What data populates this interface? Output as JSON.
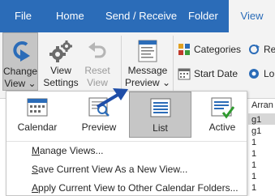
{
  "tabs": [
    "File",
    "Home",
    "Send / Receive",
    "Folder",
    "View"
  ],
  "ribbon": {
    "change_view": [
      "Change",
      "View"
    ],
    "change_view_arrow": "⌄",
    "view_settings": [
      "View",
      "Settings"
    ],
    "reset_view": [
      "Reset",
      "View"
    ],
    "message_preview": [
      "Message",
      "Preview"
    ],
    "message_preview_arrow": "⌄",
    "categories": "Categories",
    "start_date": "Start Date",
    "re_fragment": "Re",
    "lo_fragment": "Lo"
  },
  "change_view_menu": {
    "views": [
      "Calendar",
      "Preview",
      "List",
      "Active"
    ],
    "selected_view": "List",
    "commands": [
      {
        "accel": "M",
        "rest": "anage Views..."
      },
      {
        "accel": "S",
        "rest": "ave Current View As a New View..."
      },
      {
        "accel": "A",
        "rest": "pply Current View to Other Calendar Folders..."
      }
    ]
  },
  "background_fragments": {
    "arran": "Arran",
    "items": [
      "g1",
      "g1",
      "1",
      "1",
      "1",
      "1",
      "1"
    ]
  },
  "colors": {
    "accent": "#2b6cb8",
    "ribbon_bg": "#f3f3f3",
    "selected_bg": "#c6c6c6",
    "arrow": "#1f4ea8"
  }
}
